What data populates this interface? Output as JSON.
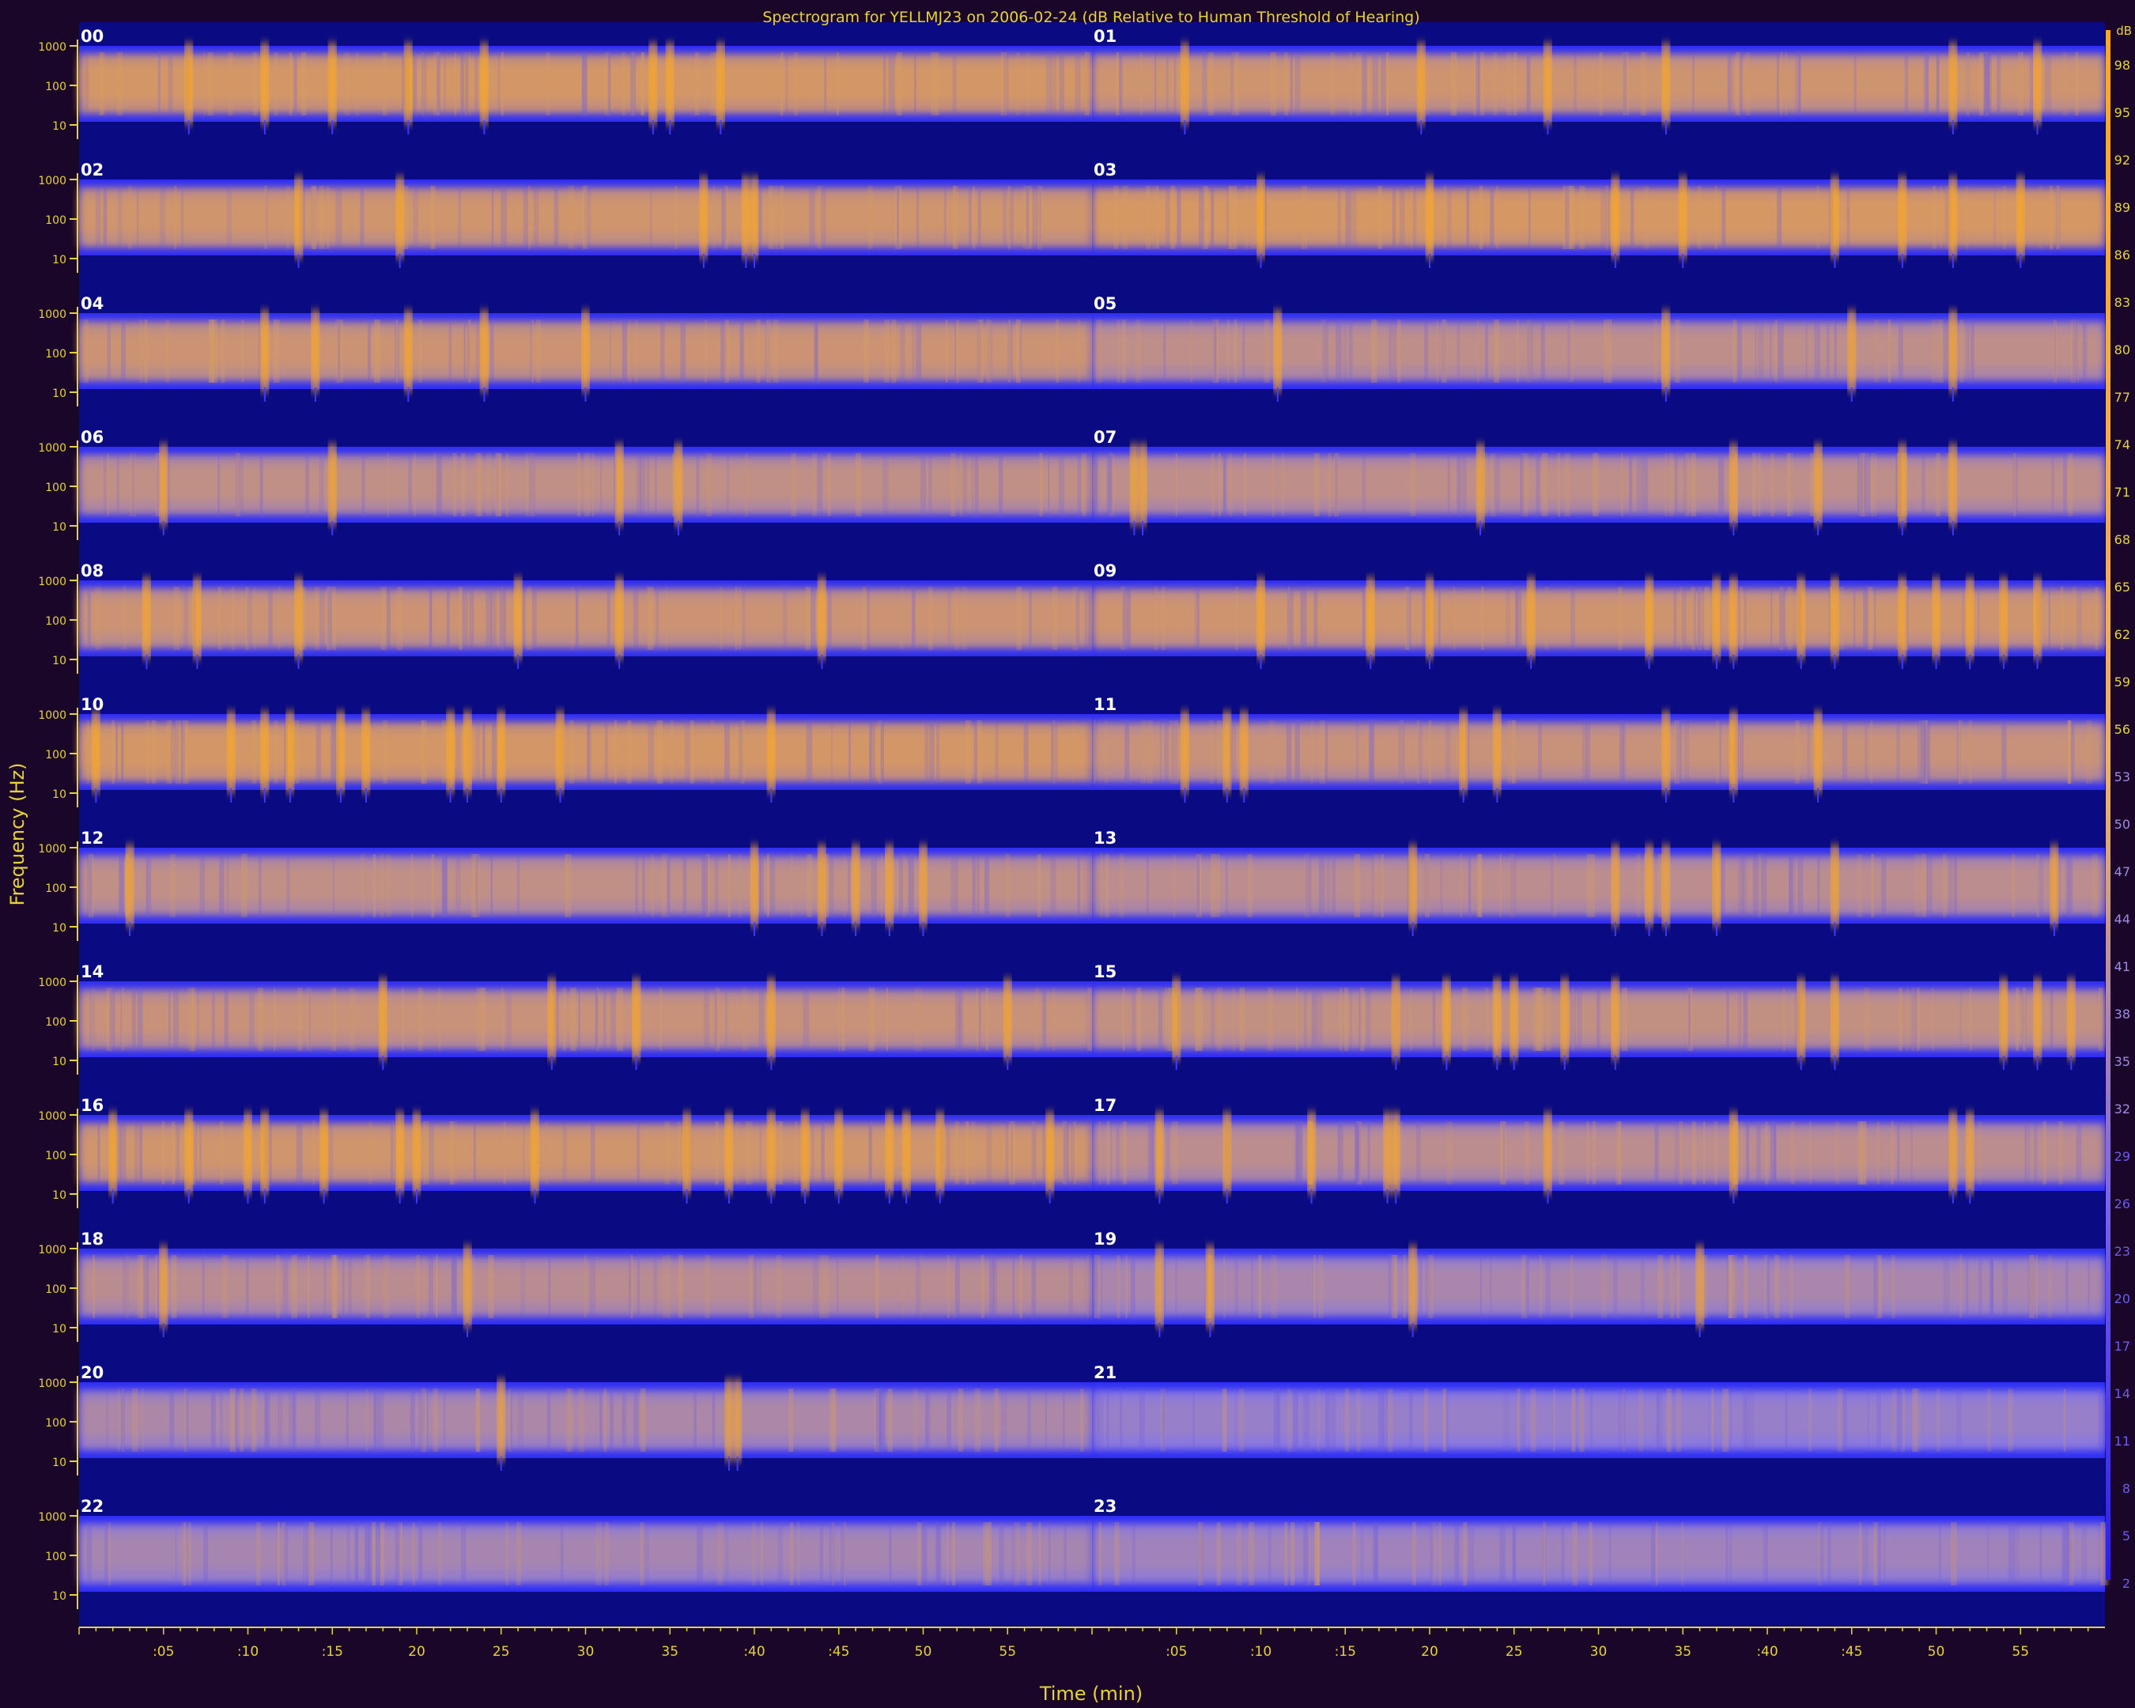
{
  "chart_data": {
    "type": "heatmap",
    "title": "Spectrogram for YELLMJ23 on 2006-02-24 (dB Relative to Human Threshold of Hearing)",
    "xlabel": "Time (min)",
    "ylabel": "Frequency (Hz)",
    "panels": [
      "00",
      "01",
      "02",
      "03",
      "04",
      "05",
      "06",
      "07",
      "08",
      "09",
      "10",
      "11",
      "12",
      "13",
      "14",
      "15",
      "16",
      "17",
      "18",
      "19",
      "20",
      "21",
      "22",
      "23"
    ],
    "freq_ticks": [
      "1000",
      "100",
      "10"
    ],
    "time_ticks": [
      ":05",
      ":10",
      ":15",
      "20",
      "25",
      "30",
      "35",
      ":40",
      ":45",
      "50",
      "55"
    ],
    "colorbar_label": "dB",
    "colorbar_ticks": [
      98,
      95,
      92,
      89,
      86,
      83,
      80,
      77,
      74,
      71,
      68,
      65,
      62,
      59,
      56,
      53,
      50,
      47,
      44,
      41,
      38,
      35,
      32,
      29,
      26,
      23,
      20,
      17,
      14,
      11,
      8,
      5,
      2
    ],
    "colorbar_range": [
      0,
      100
    ],
    "hour_intensity": [
      0.78,
      0.72,
      0.74,
      0.8,
      0.7,
      0.58,
      0.6,
      0.58,
      0.7,
      0.72,
      0.78,
      0.66,
      0.6,
      0.56,
      0.66,
      0.62,
      0.74,
      0.56,
      0.54,
      0.42,
      0.44,
      0.3,
      0.4,
      0.36
    ],
    "events": {
      "00": [
        6.5,
        11,
        15,
        19.5,
        24,
        34,
        35,
        38
      ],
      "01": [
        5.5,
        19.5,
        27,
        34,
        51,
        56
      ],
      "02": [
        13,
        19,
        37,
        39.5,
        40
      ],
      "03": [
        10,
        20,
        31,
        35,
        44,
        48,
        51,
        55
      ],
      "04": [
        11,
        14,
        19.5,
        24,
        30
      ],
      "05": [
        11,
        34,
        45,
        51
      ],
      "06": [
        5,
        15,
        32,
        35.5
      ],
      "07": [
        2.5,
        3,
        23,
        38,
        43,
        48,
        51
      ],
      "08": [
        4,
        7,
        13,
        26,
        32,
        44
      ],
      "09": [
        10,
        16.5,
        20,
        26,
        33,
        37,
        38,
        42,
        44,
        48,
        50,
        52,
        54,
        56
      ],
      "10": [
        1,
        9,
        11,
        12.5,
        15.5,
        17,
        22,
        23,
        25,
        28.5,
        41
      ],
      "11": [
        5.5,
        8,
        9,
        22,
        24,
        34,
        38,
        43
      ],
      "12": [
        3,
        40,
        44,
        46,
        48,
        50
      ],
      "13": [
        19,
        31,
        33,
        34,
        37,
        44,
        57
      ],
      "14": [
        18,
        28,
        33,
        41,
        55
      ],
      "15": [
        5,
        18,
        21,
        24,
        25,
        28,
        31,
        42,
        44,
        54,
        56,
        58
      ],
      "16": [
        2,
        6.5,
        10,
        11,
        14.5,
        19,
        20,
        27,
        36,
        38.5,
        41,
        43,
        45,
        48,
        49,
        51,
        57.5
      ],
      "17": [
        4,
        8,
        13,
        17.5,
        18,
        27,
        38,
        51,
        52
      ],
      "18": [
        5,
        23
      ],
      "19": [
        4,
        7,
        19,
        36
      ],
      "20": [
        25,
        38.5,
        39
      ],
      "21": [],
      "22": [],
      "23": []
    }
  }
}
